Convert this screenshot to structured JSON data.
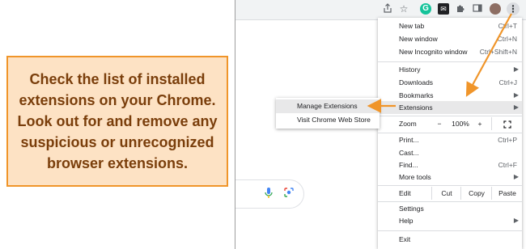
{
  "callout": {
    "text": "Check the list of installed extensions on your Chrome. Look out for and remove any suspicious or unrecognized browser extensions."
  },
  "toolbar": {
    "icons": [
      "share-icon",
      "star-icon",
      "grammarly-icon",
      "extension-blackbox-icon",
      "puzzle-icon",
      "side-panel-icon",
      "profile-avatar",
      "menu-dots-icon"
    ]
  },
  "menu": {
    "new_tab": {
      "label": "New tab",
      "shortcut": "Ctrl+T"
    },
    "new_window": {
      "label": "New window",
      "shortcut": "Ctrl+N"
    },
    "new_incognito": {
      "label": "New Incognito window",
      "shortcut": "Ctrl+Shift+N"
    },
    "history": {
      "label": "History"
    },
    "downloads": {
      "label": "Downloads",
      "shortcut": "Ctrl+J"
    },
    "bookmarks": {
      "label": "Bookmarks"
    },
    "extensions": {
      "label": "Extensions"
    },
    "zoom": {
      "label": "Zoom",
      "minus": "−",
      "value": "100%",
      "plus": "+"
    },
    "print": {
      "label": "Print...",
      "shortcut": "Ctrl+P"
    },
    "cast": {
      "label": "Cast..."
    },
    "find": {
      "label": "Find...",
      "shortcut": "Ctrl+F"
    },
    "more_tools": {
      "label": "More tools"
    },
    "edit": {
      "label": "Edit",
      "cut": "Cut",
      "copy": "Copy",
      "paste": "Paste"
    },
    "settings": {
      "label": "Settings"
    },
    "help": {
      "label": "Help"
    },
    "exit": {
      "label": "Exit"
    }
  },
  "submenu": {
    "manage": "Manage Extensions",
    "web_store": "Visit Chrome Web Store"
  },
  "colors": {
    "callout_bg": "#fde2c4",
    "callout_border": "#f0952a",
    "callout_text": "#7a3e0b",
    "arrow": "#f0952a"
  }
}
